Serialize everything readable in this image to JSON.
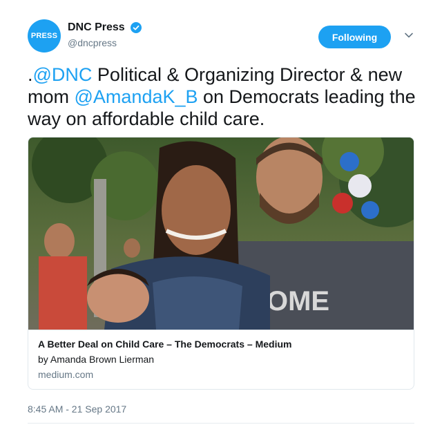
{
  "account": {
    "avatar_text": "PRESS",
    "display_name": "DNC Press",
    "handle": "@dncpress",
    "verified_icon": "verified-badge-icon",
    "follow_label": "Following",
    "menu_icon": "chevron-down-icon"
  },
  "tweet": {
    "prefix": ".",
    "mention_1": "@DNC",
    "text_1": " Political & Organizing Director & new mom ",
    "mention_2": "@AmandaK_B",
    "text_2": " on Democrats leading the way on affordable child care."
  },
  "card": {
    "title": "A Better Deal on Child Care – The Democrats – Medium",
    "author": "by Amanda Brown Lierman",
    "domain": "medium.com",
    "image_alt": "photo-of-woman-with-baby-and-man"
  },
  "timestamp": "8:45 AM - 21 Sep 2017",
  "colors": {
    "accent": "#1da1f2",
    "text": "#14171a",
    "muted": "#657786",
    "border": "#e1e8ed"
  }
}
